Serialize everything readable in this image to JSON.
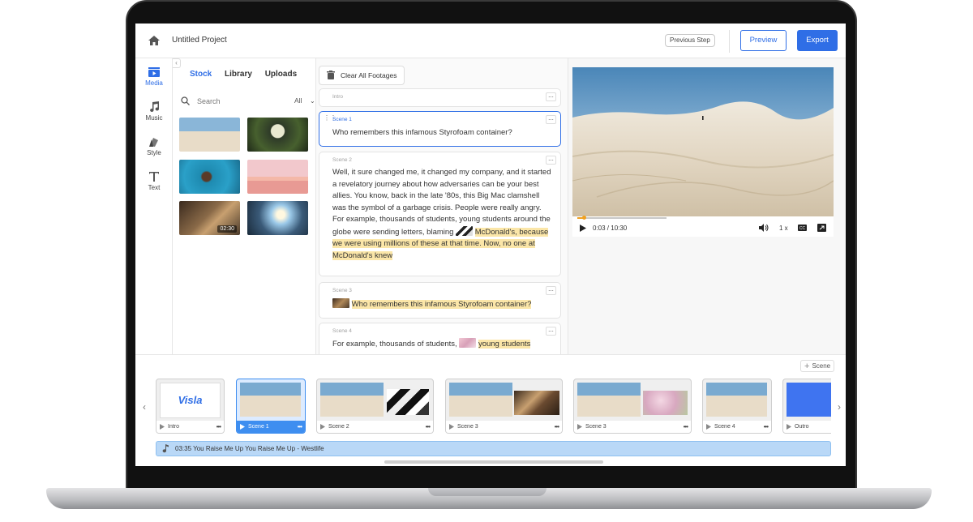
{
  "header": {
    "project_title": "Untitled Project",
    "previous_step": "Previous Step",
    "preview": "Preview",
    "export": "Export"
  },
  "rail": {
    "items": [
      {
        "label": "Media",
        "icon": "media-icon",
        "active": true
      },
      {
        "label": "Music",
        "icon": "music-icon"
      },
      {
        "label": "Style",
        "icon": "style-icon"
      },
      {
        "label": "Text",
        "icon": "text-icon"
      }
    ]
  },
  "media": {
    "tabs": [
      "Stock",
      "Library",
      "Uploads"
    ],
    "active_tab": "Stock",
    "search_placeholder": "Search",
    "filter": "All",
    "thumbnails": [
      {
        "name": "desert-beach"
      },
      {
        "name": "cocktail-plant"
      },
      {
        "name": "canoe-woman"
      },
      {
        "name": "pink-sky-van"
      },
      {
        "name": "camping-gear",
        "duration": "02:30"
      },
      {
        "name": "mountain-sunburst"
      }
    ]
  },
  "script": {
    "clear_button": "Clear All Footages",
    "scenes": [
      {
        "label": "Intro",
        "text": ""
      },
      {
        "label": "Scene 1",
        "text": "Who remembers this infamous Styrofoam container?"
      },
      {
        "label": "Scene 2",
        "text": "Well, it sure changed me, it changed my company, and it started a revelatory journey about how adversaries can be your best allies.   You know, back in the late '80s, this Big Mac clamshell was the symbol of a garbage crisis. People were really angry. For example, thousands of students, young students around the globe were sending letters, blaming",
        "highlight": "McDonald's, because we were using millions of these at that time. Now, no one at McDonald's knew"
      },
      {
        "label": "Scene 3",
        "highlight": "Who remembers this infamous Styrofoam container?"
      },
      {
        "label": "Scene 4",
        "text": "For example, thousands of students,",
        "highlight": "young students"
      }
    ]
  },
  "player": {
    "time": "0:03 / 10:30",
    "speed": "1 x",
    "progress": 0.009
  },
  "timeline": {
    "add_scene": "Scene",
    "cards": [
      {
        "label": "Intro",
        "logo": "Visla"
      },
      {
        "label": "Scene 1",
        "active": true
      },
      {
        "label": "Scene 2"
      },
      {
        "label": "Scene 3"
      },
      {
        "label": "Scene 3"
      },
      {
        "label": "Scene 4"
      },
      {
        "label": "Outro"
      }
    ],
    "music": "03:35   You Raise Me Up You Raise Me Up - Westlife"
  },
  "colors": {
    "accent": "#2f6ee6",
    "highlight": "#fbe6a8",
    "music_bar": "#b9d8f7"
  }
}
